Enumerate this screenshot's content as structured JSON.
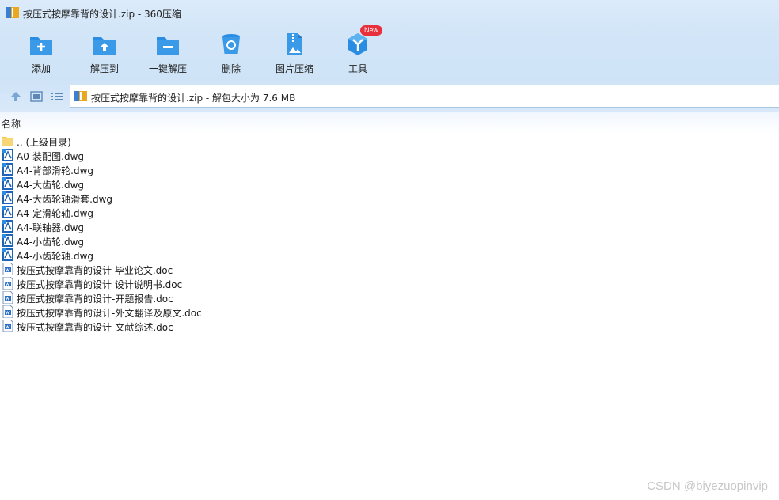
{
  "window": {
    "title": "按压式按摩靠背的设计.zip - 360压缩"
  },
  "toolbar": {
    "items": [
      {
        "label": "添加",
        "icon": "add-folder-icon"
      },
      {
        "label": "解压到",
        "icon": "extract-to-icon"
      },
      {
        "label": "一键解压",
        "icon": "one-click-extract-icon"
      },
      {
        "label": "删除",
        "icon": "delete-icon"
      },
      {
        "label": "图片压缩",
        "icon": "image-compress-icon"
      },
      {
        "label": "工具",
        "icon": "tools-icon",
        "badge": "New"
      }
    ]
  },
  "address": {
    "path": "按压式按摩靠背的设计.zip - 解包大小为 7.6 MB"
  },
  "columns": {
    "name": "名称"
  },
  "files": [
    {
      "name": ".. (上级目录)",
      "type": "folder"
    },
    {
      "name": "A0-装配图.dwg",
      "type": "dwg"
    },
    {
      "name": "A4-背部滑轮.dwg",
      "type": "dwg"
    },
    {
      "name": "A4-大齿轮.dwg",
      "type": "dwg"
    },
    {
      "name": "A4-大齿轮轴滑套.dwg",
      "type": "dwg"
    },
    {
      "name": "A4-定滑轮轴.dwg",
      "type": "dwg"
    },
    {
      "name": "A4-联轴器.dwg",
      "type": "dwg"
    },
    {
      "name": "A4-小齿轮.dwg",
      "type": "dwg"
    },
    {
      "name": "A4-小齿轮轴.dwg",
      "type": "dwg"
    },
    {
      "name": "按压式按摩靠背的设计 毕业论文.doc",
      "type": "doc"
    },
    {
      "name": "按压式按摩靠背的设计 设计说明书.doc",
      "type": "doc"
    },
    {
      "name": "按压式按摩靠背的设计-开题报告.doc",
      "type": "doc"
    },
    {
      "name": "按压式按摩靠背的设计-外文翻译及原文.doc",
      "type": "doc"
    },
    {
      "name": "按压式按摩靠背的设计-文献综述.doc",
      "type": "doc"
    }
  ],
  "watermark": "CSDN @biyezuopinvip",
  "colors": {
    "accent": "#2a8de3",
    "toolbar_bg": "#d3e6f8",
    "badge": "#e8303c"
  }
}
